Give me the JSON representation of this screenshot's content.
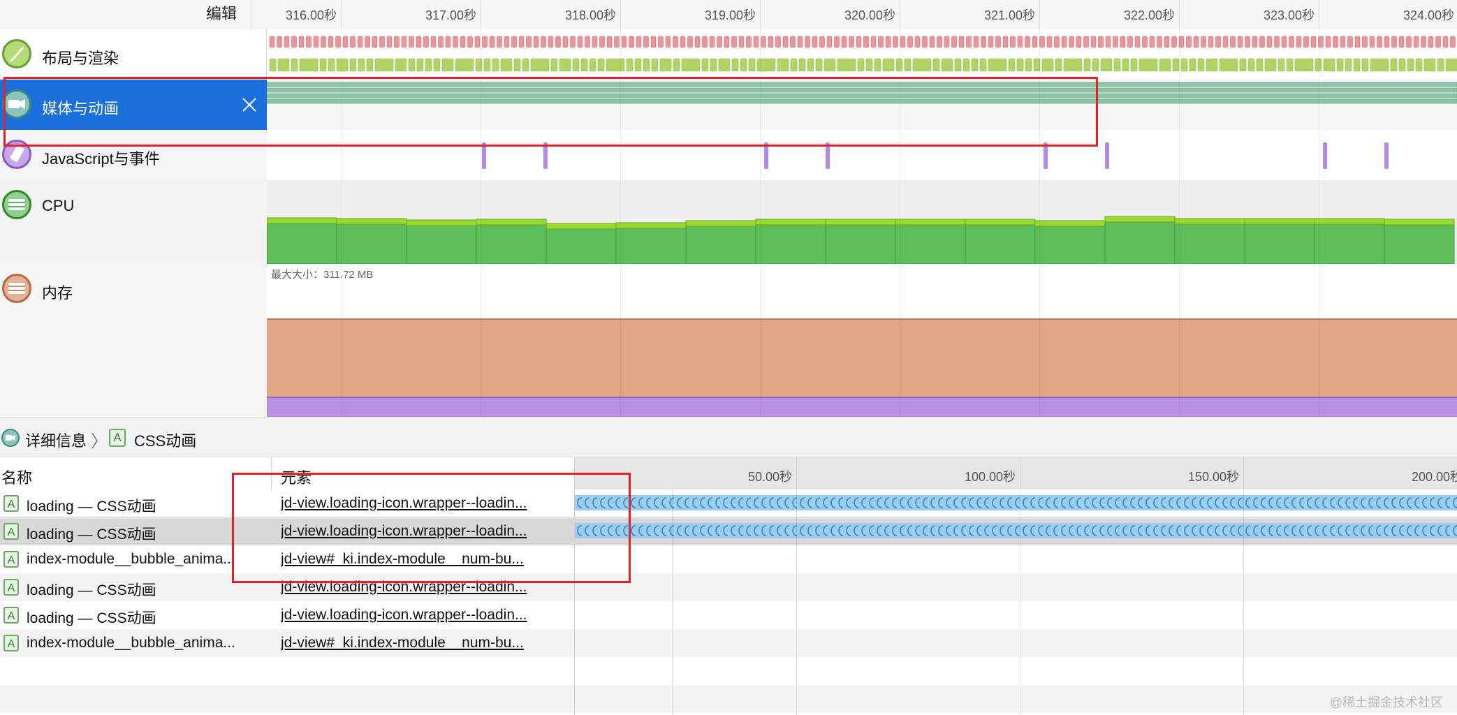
{
  "header": {
    "edit_label": "编辑"
  },
  "ruler": {
    "labels": [
      "316.00秒",
      "317.00秒",
      "318.00秒",
      "319.00秒",
      "320.00秒",
      "321.00秒",
      "322.00秒",
      "323.00秒",
      "324.00秒"
    ]
  },
  "tracks": [
    {
      "name": "布局与渲染",
      "icon": "paintbrush-icon",
      "color": "#7fb641",
      "selected": false
    },
    {
      "name": "媒体与动画",
      "icon": "video-camera-icon",
      "color": "#5fa8a0",
      "selected": true
    },
    {
      "name": "JavaScript与事件",
      "icon": "script-icon",
      "color": "#a97bd4",
      "selected": false
    },
    {
      "name": "CPU",
      "icon": "cpu-icon",
      "color": "#4cae4c",
      "selected": false
    },
    {
      "name": "内存",
      "icon": "memory-icon",
      "color": "#d48a63",
      "selected": false
    }
  ],
  "memory": {
    "max_size_label": "最大大小：311.72 MB"
  },
  "breadcrumb": {
    "item1": "详细信息",
    "item2": "CSS动画",
    "separator": "〉"
  },
  "table": {
    "col_name": "名称",
    "col_element": "元素",
    "rows": [
      {
        "name": "loading — CSS动画",
        "element": "jd-view.loading-icon.wrapper--loadin...",
        "has_bar": true
      },
      {
        "name": "loading — CSS动画",
        "element": "jd-view.loading-icon.wrapper--loadin...",
        "has_bar": true,
        "selected": true
      },
      {
        "name": "index-module__bubble_anima...",
        "element": "jd-view#_ki.index-module__num-bu...",
        "has_bar": false
      },
      {
        "name": "loading — CSS动画",
        "element": "jd-view.loading-icon.wrapper--loadin...",
        "has_bar": false
      },
      {
        "name": "loading — CSS动画",
        "element": "jd-view.loading-icon.wrapper--loadin...",
        "has_bar": false
      },
      {
        "name": "index-module__bubble_anima...",
        "element": "jd-view#_ki.index-module__num-bu...",
        "has_bar": false
      }
    ]
  },
  "detail_ruler": {
    "labels": [
      "50.00秒",
      "100.00秒",
      "150.00秒",
      "200.00秒"
    ]
  },
  "watermark": "@稀土掘金技术社区",
  "colors": {
    "selection_blue": "#1a6fdc",
    "red_annotation": "#e0222a",
    "layout_pink": "#e8959b",
    "layout_green": "#b3d366",
    "media_green": "#8cc5a5",
    "js_purple": "#b58be0",
    "cpu_green": "#5cbf5c",
    "cpu_top": "#9ad92f",
    "memory_orange": "#e0a686",
    "memory_purple": "#b98fe4",
    "anim_blue": "#9cccf0"
  }
}
